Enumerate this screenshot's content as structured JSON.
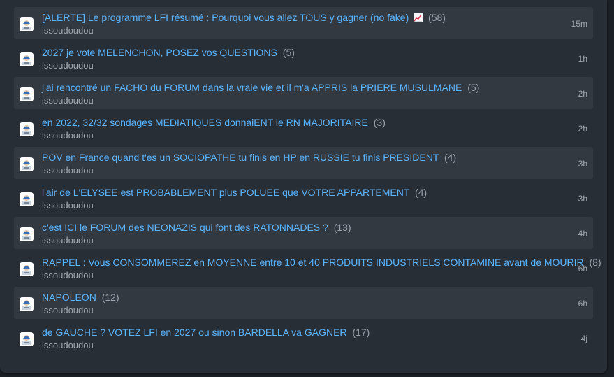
{
  "topics": [
    {
      "title": "[ALERTE] Le programme LFI résumé : Pourquoi vous allez TOUS y gagner (no fake)",
      "emoji": "chart-increasing-icon",
      "count": "(58)",
      "author": "issoudoudou",
      "time": "15m"
    },
    {
      "title": "2027 je vote MELENCHON, POSEZ vos QUESTIONS",
      "count": "(5)",
      "author": "issoudoudou",
      "time": "1h"
    },
    {
      "title": "j'ai rencontré un FACHO du FORUM dans la vraie vie et il m'a APPRIS la PRIERE MUSULMANE",
      "count": "(5)",
      "author": "issoudoudou",
      "time": "2h"
    },
    {
      "title": "en 2022, 32/32 sondages MEDIATIQUES donnaiENT le RN MAJORITAIRE",
      "count": "(3)",
      "author": "issoudoudou",
      "time": "2h"
    },
    {
      "title": "POV en France quand t'es un SOCIOPATHE tu finis en HP en RUSSIE tu finis PRESIDENT",
      "count": "(4)",
      "author": "issoudoudou",
      "time": "3h"
    },
    {
      "title": "l'air de L'ELYSEE est PROBABLEMENT plus POLUEE que VOTRE APPARTEMENT",
      "count": "(4)",
      "author": "issoudoudou",
      "time": "3h"
    },
    {
      "title": "c'est ICI le FORUM des NEONAZIS qui font des RATONNADES ?",
      "count": "(13)",
      "author": "issoudoudou",
      "time": "4h"
    },
    {
      "title": "RAPPEL : Vous CONSOMMEREZ en MOYENNE entre 10 et 40 PRODUITS INDUSTRIELS CONTAMINE avant de MOURIR",
      "count": "(8)",
      "author": "issoudoudou",
      "time": "6h"
    },
    {
      "title": "NAPOLEON",
      "count": "(12)",
      "author": "issoudoudou",
      "time": "6h"
    },
    {
      "title": "de GAUCHE ? VOTEZ LFI en 2027 ou sinon BARDELLA va GAGNER",
      "count": "(17)",
      "author": "issoudoudou",
      "time": "4j"
    }
  ]
}
